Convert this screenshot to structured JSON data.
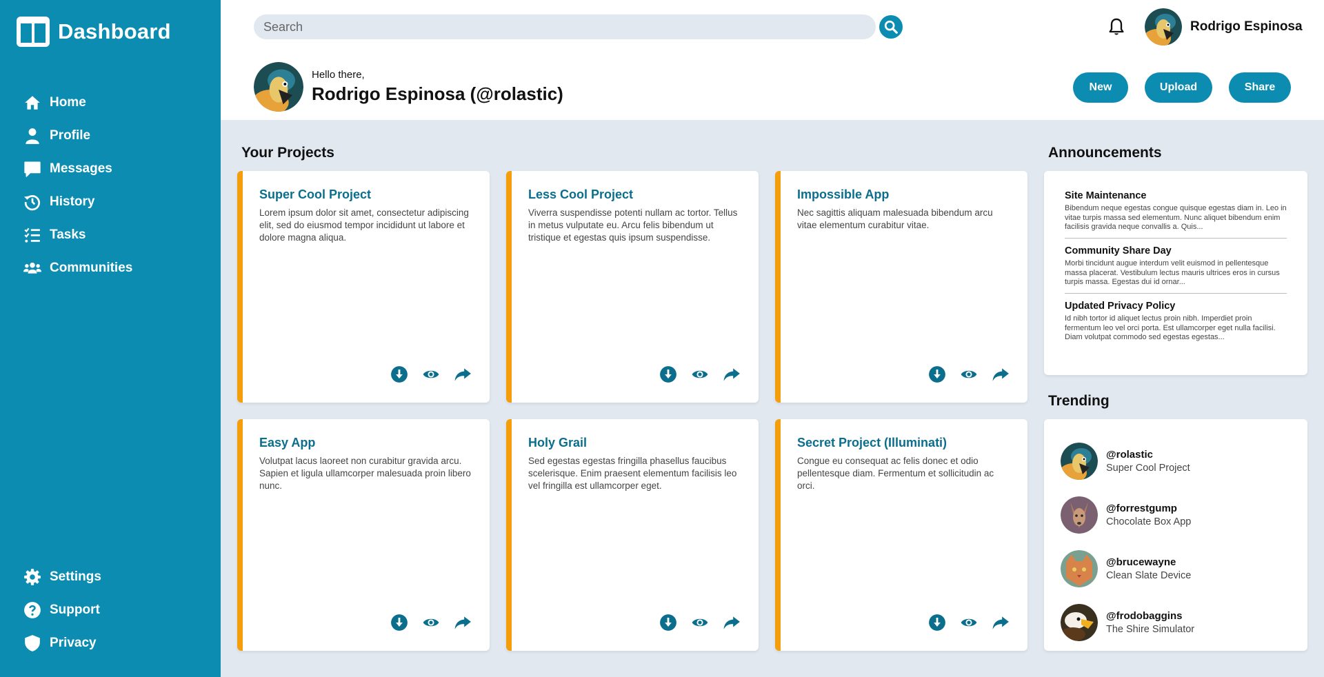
{
  "brand": {
    "title": "Dashboard"
  },
  "colors": {
    "primary": "#0b8cb0",
    "accent": "#f59e0b",
    "title_text": "#0b6e8c",
    "background": "#e2e8f0"
  },
  "sidebar": {
    "items": [
      {
        "label": "Home",
        "icon": "home-icon"
      },
      {
        "label": "Profile",
        "icon": "user-icon"
      },
      {
        "label": "Messages",
        "icon": "message-icon"
      },
      {
        "label": "History",
        "icon": "history-icon"
      },
      {
        "label": "Tasks",
        "icon": "tasks-icon"
      },
      {
        "label": "Communities",
        "icon": "users-icon"
      }
    ],
    "bottom_items": [
      {
        "label": "Settings",
        "icon": "gear-icon"
      },
      {
        "label": "Support",
        "icon": "question-icon"
      },
      {
        "label": "Privacy",
        "icon": "shield-icon"
      }
    ]
  },
  "header": {
    "search_placeholder": "Search",
    "user_name": "Rodrigo Espinosa",
    "greeting": "Hello there,",
    "greeting_name": "Rodrigo Espinosa (@rolastic)",
    "actions": {
      "new": "New",
      "upload": "Upload",
      "share": "Share"
    }
  },
  "projects": {
    "title": "Your Projects",
    "items": [
      {
        "title": "Super Cool Project",
        "desc": "Lorem ipsum dolor sit amet, consectetur adipiscing elit, sed do eiusmod tempor incididunt ut labore et dolore magna aliqua."
      },
      {
        "title": "Less Cool Project",
        "desc": "Viverra suspendisse potenti nullam ac tortor. Tellus in metus vulputate eu. Arcu felis bibendum ut tristique et egestas quis ipsum suspendisse."
      },
      {
        "title": "Impossible App",
        "desc": "Nec sagittis aliquam malesuada bibendum arcu vitae elementum curabitur vitae."
      },
      {
        "title": "Easy App",
        "desc": "Volutpat lacus laoreet non curabitur gravida arcu. Sapien et ligula ullamcorper malesuada proin libero nunc."
      },
      {
        "title": "Holy Grail",
        "desc": "Sed egestas egestas fringilla phasellus faucibus scelerisque. Enim praesent elementum facilisis leo vel fringilla est ullamcorper eget."
      },
      {
        "title": "Secret Project (Illuminati)",
        "desc": "Congue eu consequat ac felis donec et odio pellentesque diam. Fermentum et sollicitudin ac orci."
      }
    ]
  },
  "announcements": {
    "title": "Announcements",
    "items": [
      {
        "title": "Site Maintenance",
        "body": "Bibendum neque egestas congue quisque egestas diam in. Leo in vitae turpis massa sed elementum. Nunc aliquet bibendum enim facilisis gravida neque convallis a. Quis..."
      },
      {
        "title": "Community Share Day",
        "body": "Morbi tincidunt augue interdum velit euismod in pellentesque massa placerat. Vestibulum lectus mauris ultrices eros in cursus turpis massa. Egestas dui id ornar..."
      },
      {
        "title": "Updated Privacy Policy",
        "body": "Id nibh tortor id aliquet lectus proin nibh. Imperdiet proin fermentum leo vel orci porta. Est ullamcorper eget nulla facilisi. Diam volutpat commodo sed egestas egestas..."
      }
    ]
  },
  "trending": {
    "title": "Trending",
    "items": [
      {
        "handle": "@rolastic",
        "project": "Super Cool Project"
      },
      {
        "handle": "@forrestgump",
        "project": "Chocolate Box App"
      },
      {
        "handle": "@brucewayne",
        "project": "Clean Slate Device"
      },
      {
        "handle": "@frodobaggins",
        "project": "The Shire Simulator"
      }
    ]
  }
}
